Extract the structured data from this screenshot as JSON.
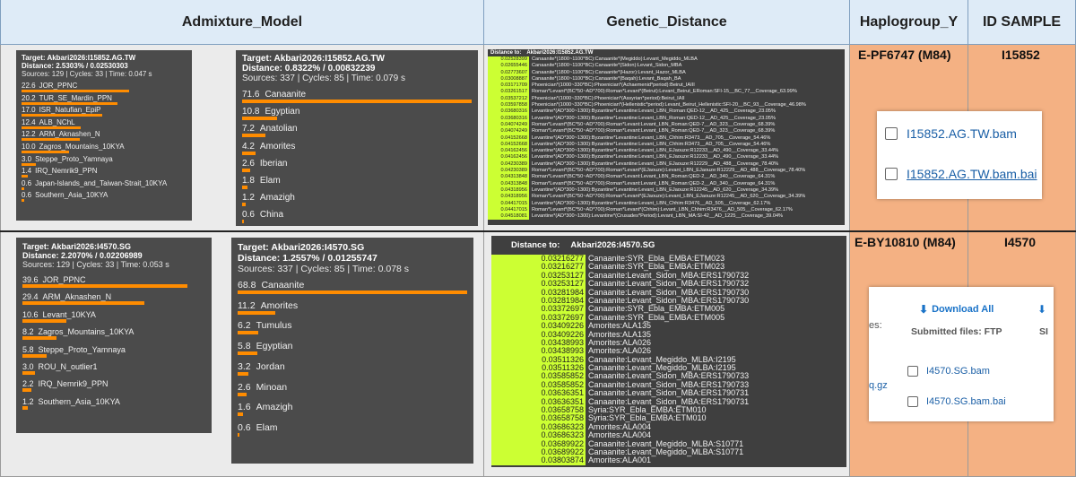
{
  "headers": {
    "admixture": "Admixture_Model",
    "distance": "Genetic_Distance",
    "haplogroup": "Haplogroup_Y",
    "id": "ID SAMPLE"
  },
  "colors": {
    "header_bg": "#deebf7",
    "admix_cell_bg": "#ebebeb",
    "haplo_cell_bg": "#f4b183",
    "panel_bg": "#4b4b4b",
    "bar": "#ff8c00",
    "distance_value_bg": "#ccff33"
  },
  "row1": {
    "haplogroup": "E-PF6747 (M84)",
    "id": "I15852",
    "panel_a": {
      "target": "Target: Akbari2026:I15852.AG.TW",
      "distance": "Distance: 2.5303% / 0.02530303",
      "meta": "Sources: 129 | Cycles: 33 | Time: 0.047 s",
      "items": [
        {
          "value": "22.6",
          "label": "JOR_PPNC"
        },
        {
          "value": "20.2",
          "label": "TUR_SE_Mardin_PPN"
        },
        {
          "value": "17.0",
          "label": "ISR_Natufian_EpiP"
        },
        {
          "value": "12.4",
          "label": "ALB_NChL"
        },
        {
          "value": "12.2",
          "label": "ARM_Aknashen_N"
        },
        {
          "value": "10.0",
          "label": "Zagros_Mountains_10KYA"
        },
        {
          "value": "3.0",
          "label": "Steppe_Proto_Yamnaya"
        },
        {
          "value": "1.4",
          "label": "IRQ_Nemrik9_PPN"
        },
        {
          "value": "0.6",
          "label": "Japan-Islands_and_Taiwan-Strait_10KYA"
        },
        {
          "value": "0.6",
          "label": "Southern_Asia_10KYA"
        }
      ]
    },
    "panel_b": {
      "target": "Target: Akbari2026:I15852.AG.TW",
      "distance": "Distance: 0.8322% / 0.00832239",
      "meta": "Sources: 337 | Cycles: 85 | Time: 0.079 s",
      "items": [
        {
          "value": "71.6",
          "label": "Canaanite"
        },
        {
          "value": "10.8",
          "label": "Egyptian"
        },
        {
          "value": "7.2",
          "label": "Anatolian"
        },
        {
          "value": "4.2",
          "label": "Amorites"
        },
        {
          "value": "2.6",
          "label": "Iberian"
        },
        {
          "value": "1.8",
          "label": "Elam"
        },
        {
          "value": "1.2",
          "label": "Amazigh"
        },
        {
          "value": "0.6",
          "label": "China"
        }
      ]
    },
    "dist": {
      "header_label": "Distance to:",
      "header_target": "Akbari2026:I15852.AG.TW",
      "rows": [
        {
          "v": "0.02528399",
          "l": "Canaanite*(1800~1100*BC):Canaanite*(Megiddo):Levant_Megiddo_MLBA"
        },
        {
          "v": "0.02655446",
          "l": "Canaanite*(1800~1100*BC):Canaanite*(Sidon):Levant_Sidon_MBA"
        },
        {
          "v": "0.02773607",
          "l": "Canaanite*(1800~1100*BC):Canaanite*(Hazor):Levant_Hazor_MLBA"
        },
        {
          "v": "0.03008887",
          "l": "Canaanite*(1800~1100*BC):Canaanite*(Baqah):Levant_Baqah_BA"
        },
        {
          "v": "0.03171709",
          "l": "Phoenician*(1000~330*BC):Phoenician*(Achaemenid*period):Beirut_IAIII"
        },
        {
          "v": "0.03261517",
          "l": "Roman*Levant*(BC*50~AD*700):Roman*Levant*(Beirut):Levant_Beirut_ERoman:SFI-15__BC_77__Coverage_63.99%"
        },
        {
          "v": "0.03537212",
          "l": "Phoenician*(1000~330*BC):Phoenician*(Assyrian*period):Beirut_IAII"
        },
        {
          "v": "0.03597858",
          "l": "Phoenician*(1000~330*BC):Phoenician*(Hellenistic*period):Levant_Beirut_Hellenistic:SFI-20__BC_93__Coverage_46.98%"
        },
        {
          "v": "0.03680316",
          "l": "Levantine*(AD*300~1300):Byzantine*Levantine:Levant_LBN_Roman:QED-12__AD_425__Coverage_23.05%"
        },
        {
          "v": "0.03680316",
          "l": "Levantine*(AD*300~1300):Byzantine*Levantine:Levant_LBN_Roman:QED-12__AD_425__Coverage_23.05%"
        },
        {
          "v": "0.04074249",
          "l": "Roman*Levant*(BC*50~AD*700):Roman*Levant:Levant_LBN_Roman:QED-7__AD_323__Coverage_68.39%"
        },
        {
          "v": "0.04074249",
          "l": "Roman*Levant*(BC*50~AD*700):Roman*Levant:Levant_LBN_Roman:QED-7__AD_323__Coverage_68.39%"
        },
        {
          "v": "0.04152668",
          "l": "Levantine*(AD*300~1300):Byzantine*Levantine:Levant_LBN_Chhim:R3473__AD_705__Coverage_54.46%"
        },
        {
          "v": "0.04152668",
          "l": "Levantine*(AD*300~1300):Byzantine*Levantine:Levant_LBN_Chhim:R3473__AD_705__Coverage_54.46%"
        },
        {
          "v": "0.04162456",
          "l": "Levantine*(AD*300~1300):Byzantine*Levantine:Levant_LBN_EJaouze:R12233__AD_490__Coverage_33.44%"
        },
        {
          "v": "0.04162456",
          "l": "Levantine*(AD*300~1300):Byzantine*Levantine:Levant_LBN_EJaouze:R12233__AD_490__Coverage_33.44%"
        },
        {
          "v": "0.04230389",
          "l": "Levantine*(AD*300~1300):Byzantine*Levantine:Levant_LBN_EJaouze:R12229__AD_488__Coverage_78.40%"
        },
        {
          "v": "0.04230389",
          "l": "Roman*Levant*(BC*50~AD*700):Roman*Levant*(EJaouze):Levant_LBN_EJaouze:R12229__AD_488__Coverage_78.40%"
        },
        {
          "v": "0.04313848",
          "l": "Roman*Levant*(BC*50~AD*700):Roman*Levant:Levant_LBN_Roman:QED-2__AD_340__Coverage_64.31%"
        },
        {
          "v": "0.04313848",
          "l": "Roman*Levant*(BC*50~AD*700):Roman*Levant:Levant_LBN_Roman:QED-2__AD_340__Coverage_64.31%"
        },
        {
          "v": "0.04318956",
          "l": "Levantine*(AD*300~1300):Byzantine*Levantine:Levant_LBN_EJaouze:R12245__AD_620__Coverage_34.39%"
        },
        {
          "v": "0.04318956",
          "l": "Roman*Levant*(BC*50~AD*700):Roman*Levant*(EJaouze):Levant_LBN_EJaouze:R12245__AD_620__Coverage_34.39%"
        },
        {
          "v": "0.04417015",
          "l": "Levantine*(AD*300~1300):Byzantine*Levantine:Levant_LBN_Chhim:R3476__AD_505__Coverage_62.17%"
        },
        {
          "v": "0.04417015",
          "l": "Roman*Levant*(BC*50~AD*700):Roman*Levant*(Chhim):Levant_LBN_Chhim:R3476__AD_505__Coverage_62.17%"
        },
        {
          "v": "0.04518081",
          "l": "Levantine*(AD*300~1300):Levantine*(Crusades*Period):Levant_LBN_MA:SI-42__AD_1225__Coverage_39.04%"
        }
      ]
    },
    "files": {
      "bam": "I15852.AG.TW.bam",
      "bai": "I15852.AG.TW.bam.bai"
    }
  },
  "row2": {
    "haplogroup": "E-BY10810 (M84)",
    "id": "I4570",
    "panel_a": {
      "target": "Target: Akbari2026:I4570.SG",
      "distance": "Distance: 2.2070% / 0.02206989",
      "meta": "Sources: 129 | Cycles: 33 | Time: 0.053 s",
      "items": [
        {
          "value": "39.6",
          "label": "JOR_PPNC"
        },
        {
          "value": "29.4",
          "label": "ARM_Aknashen_N"
        },
        {
          "value": "10.6",
          "label": "Levant_10KYA"
        },
        {
          "value": "8.2",
          "label": "Zagros_Mountains_10KYA"
        },
        {
          "value": "5.8",
          "label": "Steppe_Proto_Yamnaya"
        },
        {
          "value": "3.0",
          "label": "ROU_N_outlier1"
        },
        {
          "value": "2.2",
          "label": "IRQ_Nemrik9_PPN"
        },
        {
          "value": "1.2",
          "label": "Southern_Asia_10KYA"
        }
      ]
    },
    "panel_b": {
      "target": "Target: Akbari2026:I4570.SG",
      "distance": "Distance: 1.2557% / 0.01255747",
      "meta": "Sources: 337 | Cycles: 85 | Time: 0.078 s",
      "items": [
        {
          "value": "68.8",
          "label": "Canaanite"
        },
        {
          "value": "11.2",
          "label": "Amorites"
        },
        {
          "value": "6.2",
          "label": "Tumulus"
        },
        {
          "value": "5.8",
          "label": "Egyptian"
        },
        {
          "value": "3.2",
          "label": "Jordan"
        },
        {
          "value": "2.6",
          "label": "Minoan"
        },
        {
          "value": "1.6",
          "label": "Amazigh"
        },
        {
          "value": "0.6",
          "label": "Elam"
        }
      ]
    },
    "dist": {
      "header_label": "Distance to:",
      "header_target": "Akbari2026:I4570.SG",
      "rows": [
        {
          "v": "0.03216277",
          "l": "Canaanite:SYR_Ebla_EMBA:ETM023"
        },
        {
          "v": "0.03216277",
          "l": "Canaanite:SYR_Ebla_EMBA:ETM023"
        },
        {
          "v": "0.03253127",
          "l": "Canaanite:Levant_Sidon_MBA:ERS1790732"
        },
        {
          "v": "0.03253127",
          "l": "Canaanite:Levant_Sidon_MBA:ERS1790732"
        },
        {
          "v": "0.03281984",
          "l": "Canaanite:Levant_Sidon_MBA:ERS1790730"
        },
        {
          "v": "0.03281984",
          "l": "Canaanite:Levant_Sidon_MBA:ERS1790730"
        },
        {
          "v": "0.03372697",
          "l": "Canaanite:SYR_Ebla_EMBA:ETM005"
        },
        {
          "v": "0.03372697",
          "l": "Canaanite:SYR_Ebla_EMBA:ETM005"
        },
        {
          "v": "0.03409226",
          "l": "Amorites:ALA135"
        },
        {
          "v": "0.03409226",
          "l": "Amorites:ALA135"
        },
        {
          "v": "0.03438993",
          "l": "Amorites:ALA026"
        },
        {
          "v": "0.03438993",
          "l": "Amorites:ALA026"
        },
        {
          "v": "0.03511326",
          "l": "Canaanite:Levant_Megiddo_MLBA:I2195"
        },
        {
          "v": "0.03511326",
          "l": "Canaanite:Levant_Megiddo_MLBA:I2195"
        },
        {
          "v": "0.03585852",
          "l": "Canaanite:Levant_Sidon_MBA:ERS1790733"
        },
        {
          "v": "0.03585852",
          "l": "Canaanite:Levant_Sidon_MBA:ERS1790733"
        },
        {
          "v": "0.03636351",
          "l": "Canaanite:Levant_Sidon_MBA:ERS1790731"
        },
        {
          "v": "0.03636351",
          "l": "Canaanite:Levant_Sidon_MBA:ERS1790731"
        },
        {
          "v": "0.03658758",
          "l": "Syria:SYR_Ebla_EMBA:ETM010"
        },
        {
          "v": "0.03658758",
          "l": "Syria:SYR_Ebla_EMBA:ETM010"
        },
        {
          "v": "0.03686323",
          "l": "Amorites:ALA004"
        },
        {
          "v": "0.03686323",
          "l": "Amorites:ALA004"
        },
        {
          "v": "0.03689922",
          "l": "Canaanite:Levant_Megiddo_MLBA:S10771"
        },
        {
          "v": "0.03689922",
          "l": "Canaanite:Levant_Megiddo_MLBA:S10771"
        },
        {
          "v": "0.03803874",
          "l": "Amorites:ALA001"
        }
      ]
    },
    "files": {
      "download_all": "Download All",
      "submitted": "Submitted files: FTP",
      "side_letter": "SI",
      "side_label": "es:",
      "side_ext": "q.gz",
      "bam": "I4570.SG.bam",
      "bai": "I4570.SG.bam.bai"
    }
  }
}
